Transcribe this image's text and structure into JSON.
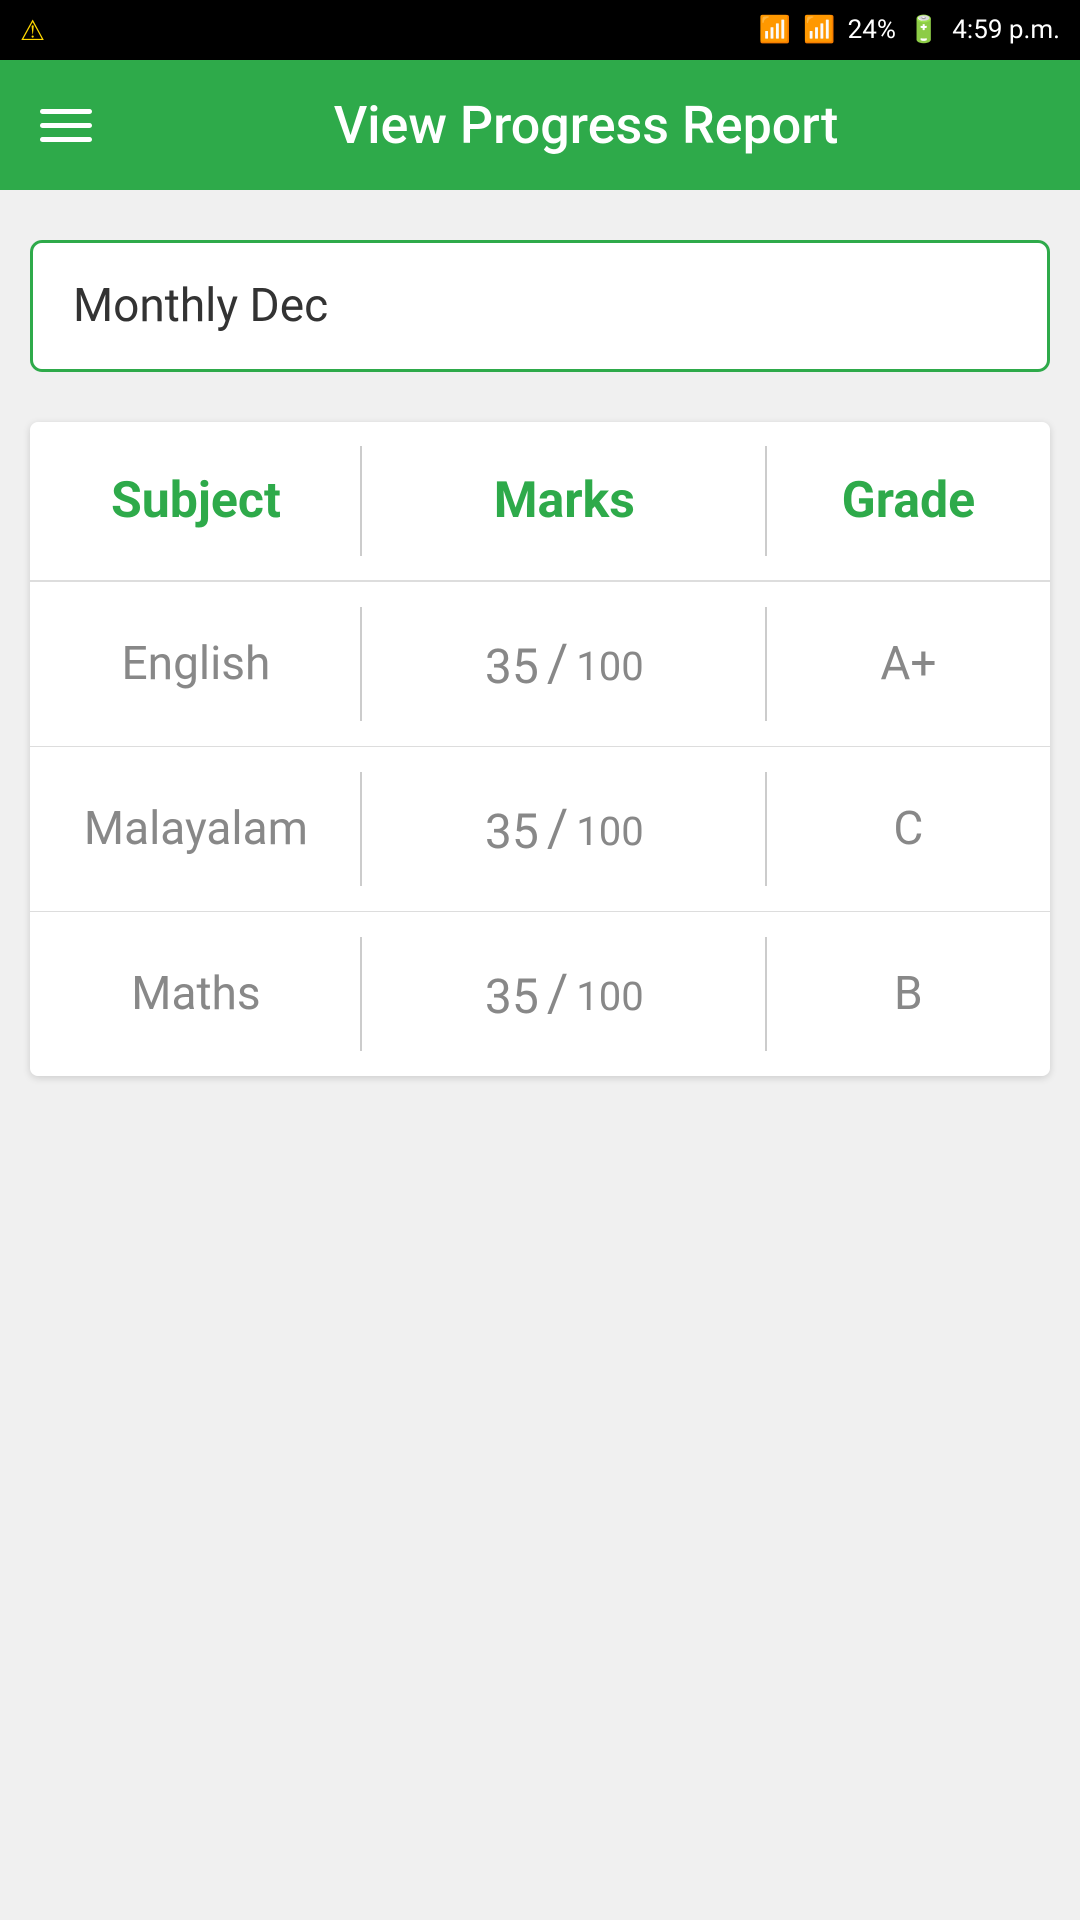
{
  "statusBar": {
    "battery": "24%",
    "time": "4:59 p.m.",
    "warningIcon": "⚠",
    "wifiIcon": "wifi",
    "signalIcon": "signal",
    "batteryIcon": "battery"
  },
  "appBar": {
    "title": "View Progress Report",
    "menuIcon": "hamburger"
  },
  "filterBox": {
    "value": "Monthly Dec"
  },
  "table": {
    "headers": {
      "subject": "Subject",
      "marks": "Marks",
      "grade": "Grade"
    },
    "rows": [
      {
        "subject": "English",
        "marksNumerator": "35",
        "marksDenominator": "100",
        "grade": "A+"
      },
      {
        "subject": "Malayalam",
        "marksNumerator": "35",
        "marksDenominator": "100",
        "grade": "C"
      },
      {
        "subject": "Maths",
        "marksNumerator": "35",
        "marksDenominator": "100",
        "grade": "B"
      }
    ]
  }
}
